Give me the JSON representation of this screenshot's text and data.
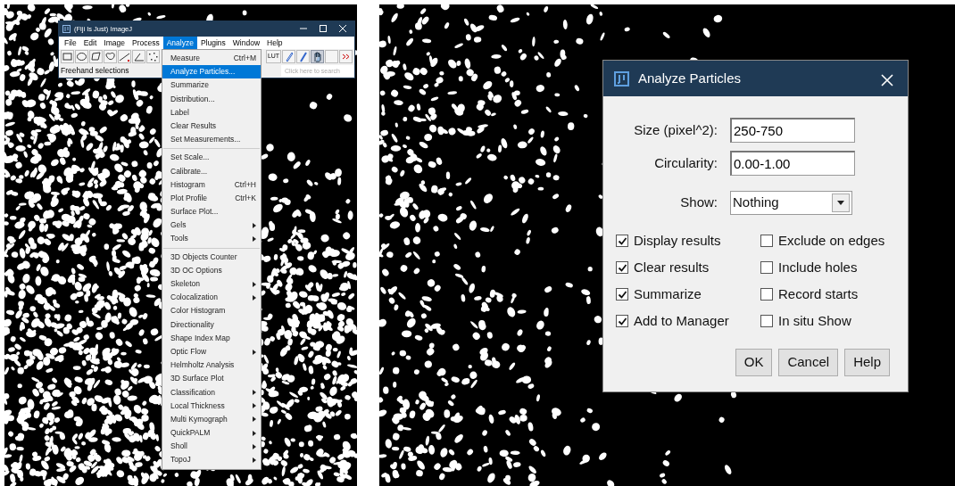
{
  "imagej_window": {
    "title": "(Fiji Is Just) ImageJ",
    "menus": [
      {
        "label": "File",
        "selected": false
      },
      {
        "label": "Edit",
        "selected": false
      },
      {
        "label": "Image",
        "selected": false
      },
      {
        "label": "Process",
        "selected": false
      },
      {
        "label": "Analyze",
        "selected": true
      },
      {
        "label": "Plugins",
        "selected": false
      },
      {
        "label": "Window",
        "selected": false
      },
      {
        "label": "Help",
        "selected": false
      }
    ],
    "toolbar": {
      "left": [
        {
          "kind": "rectangle",
          "selected": false
        },
        {
          "kind": "oval",
          "selected": false
        },
        {
          "kind": "polygon",
          "selected": false
        },
        {
          "kind": "freehand",
          "selected": false
        },
        {
          "kind": "line",
          "selected": false
        },
        {
          "kind": "angle",
          "selected": false
        },
        {
          "kind": "points",
          "selected": false
        }
      ],
      "right": [
        {
          "kind": "lut",
          "label": "LUT",
          "selected": false
        },
        {
          "kind": "pen",
          "selected": false
        },
        {
          "kind": "brush",
          "selected": false
        },
        {
          "kind": "hand",
          "selected": true
        },
        {
          "kind": "blank",
          "selected": false
        },
        {
          "kind": "more",
          "selected": false
        }
      ]
    },
    "status": "Freehand selections",
    "search": {
      "placeholder": "Click here to search"
    }
  },
  "analyze_menu": [
    {
      "kind": "item",
      "label": "Measure",
      "shortcut": "Ctrl+M",
      "selected": false,
      "submenu": false
    },
    {
      "kind": "item",
      "label": "Analyze Particles...",
      "selected": true,
      "submenu": false
    },
    {
      "kind": "item",
      "label": "Summarize",
      "selected": false,
      "submenu": false
    },
    {
      "kind": "item",
      "label": "Distribution...",
      "selected": false,
      "submenu": false
    },
    {
      "kind": "item",
      "label": "Label",
      "selected": false,
      "submenu": false
    },
    {
      "kind": "item",
      "label": "Clear Results",
      "selected": false,
      "submenu": false
    },
    {
      "kind": "item",
      "label": "Set Measurements...",
      "selected": false,
      "submenu": false
    },
    {
      "kind": "separator"
    },
    {
      "kind": "item",
      "label": "Set Scale...",
      "selected": false,
      "submenu": false
    },
    {
      "kind": "item",
      "label": "Calibrate...",
      "selected": false,
      "submenu": false
    },
    {
      "kind": "item",
      "label": "Histogram",
      "shortcut": "Ctrl+H",
      "selected": false,
      "submenu": false
    },
    {
      "kind": "item",
      "label": "Plot Profile",
      "shortcut": "Ctrl+K",
      "selected": false,
      "submenu": false
    },
    {
      "kind": "item",
      "label": "Surface Plot...",
      "selected": false,
      "submenu": false
    },
    {
      "kind": "item",
      "label": "Gels",
      "selected": false,
      "submenu": true
    },
    {
      "kind": "item",
      "label": "Tools",
      "selected": false,
      "submenu": true
    },
    {
      "kind": "separator"
    },
    {
      "kind": "item",
      "label": "3D Objects Counter",
      "selected": false,
      "submenu": false
    },
    {
      "kind": "item",
      "label": "3D OC Options",
      "selected": false,
      "submenu": false
    },
    {
      "kind": "item",
      "label": "Skeleton",
      "selected": false,
      "submenu": true
    },
    {
      "kind": "item",
      "label": "Colocalization",
      "selected": false,
      "submenu": true
    },
    {
      "kind": "item",
      "label": "Color Histogram",
      "selected": false,
      "submenu": false
    },
    {
      "kind": "item",
      "label": "Directionality",
      "selected": false,
      "submenu": false
    },
    {
      "kind": "item",
      "label": "Shape Index Map",
      "selected": false,
      "submenu": false
    },
    {
      "kind": "item",
      "label": "Optic Flow",
      "selected": false,
      "submenu": true
    },
    {
      "kind": "item",
      "label": "Helmholtz Analysis",
      "selected": false,
      "submenu": false
    },
    {
      "kind": "item",
      "label": "3D Surface Plot",
      "selected": false,
      "submenu": false
    },
    {
      "kind": "item",
      "label": "Classification",
      "selected": false,
      "submenu": true
    },
    {
      "kind": "item",
      "label": "Local Thickness",
      "selected": false,
      "submenu": true
    },
    {
      "kind": "item",
      "label": "Multi Kymograph",
      "selected": false,
      "submenu": true
    },
    {
      "kind": "item",
      "label": "QuickPALM",
      "selected": false,
      "submenu": true
    },
    {
      "kind": "item",
      "label": "Sholl",
      "selected": false,
      "submenu": true
    },
    {
      "kind": "item",
      "label": "TopoJ",
      "selected": false,
      "submenu": true
    }
  ],
  "dialog": {
    "title": "Analyze Particles",
    "fields": [
      {
        "label": "Size (pixel^2):",
        "value": "250-750"
      },
      {
        "label": "Circularity:",
        "value": "0.00-1.00"
      }
    ],
    "show": {
      "label": "Show:",
      "value": "Nothing"
    },
    "options": [
      {
        "label": "Display results",
        "checked": true
      },
      {
        "label": "Exclude on edges",
        "checked": false
      },
      {
        "label": "Clear results",
        "checked": true
      },
      {
        "label": "Include holes",
        "checked": false
      },
      {
        "label": "Summarize",
        "checked": true
      },
      {
        "label": "Record starts",
        "checked": false
      },
      {
        "label": "Add to Manager",
        "checked": true
      },
      {
        "label": "In situ Show",
        "checked": false
      }
    ],
    "buttons": [
      "OK",
      "Cancel",
      "Help"
    ]
  }
}
